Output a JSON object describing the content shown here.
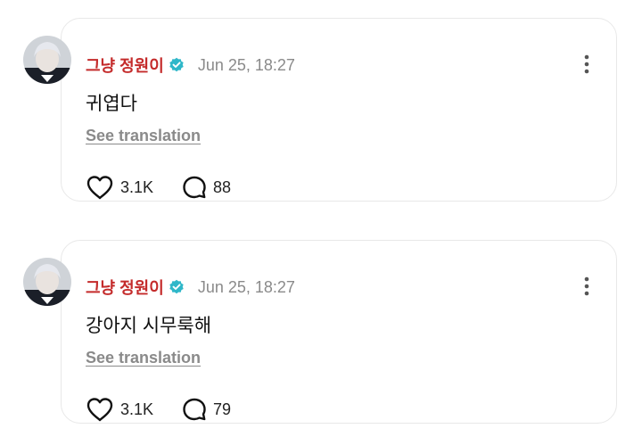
{
  "colors": {
    "name": "#c42b2b",
    "verified": "#2fb7c9",
    "muted": "#8a8a8a"
  },
  "posts": [
    {
      "author": "그냥 정원이",
      "verified_icon": "verified-badge-icon",
      "timestamp": "Jun 25, 18:27",
      "text": "귀엽다",
      "translation_link": "See translation",
      "likes": "3.1K",
      "comments": "88"
    },
    {
      "author": "그냥 정원이",
      "verified_icon": "verified-badge-icon",
      "timestamp": "Jun 25, 18:27",
      "text": "강아지 시무룩해",
      "translation_link": "See translation",
      "likes": "3.1K",
      "comments": "79"
    }
  ]
}
